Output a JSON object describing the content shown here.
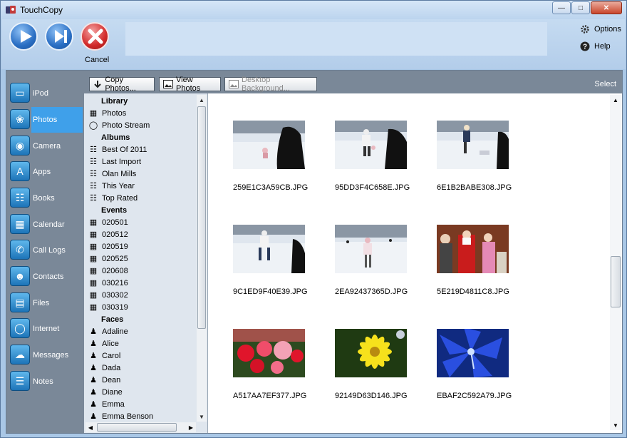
{
  "window": {
    "title": "TouchCopy"
  },
  "toolbar": {
    "cancel_label": "Cancel",
    "options_label": "Options",
    "help_label": "Help"
  },
  "nav": {
    "items": [
      {
        "label": "iPod",
        "icon": "ipod-icon",
        "active": false
      },
      {
        "label": "Photos",
        "icon": "photos-icon",
        "active": true
      },
      {
        "label": "Camera",
        "icon": "camera-icon",
        "active": false
      },
      {
        "label": "Apps",
        "icon": "apps-icon",
        "active": false
      },
      {
        "label": "Books",
        "icon": "books-icon",
        "active": false
      },
      {
        "label": "Calendar",
        "icon": "calendar-icon",
        "active": false
      },
      {
        "label": "Call Logs",
        "icon": "phone-icon",
        "active": false
      },
      {
        "label": "Contacts",
        "icon": "contacts-icon",
        "active": false
      },
      {
        "label": "Files",
        "icon": "folder-icon",
        "active": false
      },
      {
        "label": "Internet",
        "icon": "globe-icon",
        "active": false
      },
      {
        "label": "Messages",
        "icon": "speech-bubble-icon",
        "active": false
      },
      {
        "label": "Notes",
        "icon": "notes-icon",
        "active": false
      }
    ]
  },
  "actions": {
    "copy_photos": "Copy Photos...",
    "view_photos": "View Photos",
    "desktop_background": "Desktop Background...",
    "select": "Select"
  },
  "tree": {
    "library_heading": "Library",
    "library": [
      "Photos",
      "Photo Stream"
    ],
    "albums_heading": "Albums",
    "albums": [
      "Best Of 2011",
      "Last Import",
      "Olan Mills",
      "This Year",
      "Top Rated"
    ],
    "events_heading": "Events",
    "events": [
      "020501",
      "020512",
      "020519",
      "020525",
      "020608",
      "030216",
      "030302",
      "030319"
    ],
    "faces_heading": "Faces",
    "faces": [
      "Adaline",
      "Alice",
      "Carol",
      "Dada",
      "Dean",
      "Diane",
      "Emma",
      "Emma Benson"
    ]
  },
  "photos": [
    {
      "name": "259E1C3A59CB.JPG",
      "scene": "ice-rink"
    },
    {
      "name": "95DD3F4C658E.JPG",
      "scene": "ice-rink"
    },
    {
      "name": "6E1B2BABE308.JPG",
      "scene": "ice-rink"
    },
    {
      "name": "9C1ED9F40E39.JPG",
      "scene": "ice-rink"
    },
    {
      "name": "2EA92437365D.JPG",
      "scene": "ice-rink"
    },
    {
      "name": "5E219D4811C8.JPG",
      "scene": "santa"
    },
    {
      "name": "A517AA7EF377.JPG",
      "scene": "red-flowers"
    },
    {
      "name": "92149D63D146.JPG",
      "scene": "yellow-flower"
    },
    {
      "name": "EBAF2C592A79.JPG",
      "scene": "blue-flower"
    }
  ],
  "colors": {
    "nav_bg": "#7a8898",
    "nav_active": "#3fa0ea",
    "tree_bg": "#dfe6ee",
    "toolbar_bg": "#b3cdea"
  }
}
